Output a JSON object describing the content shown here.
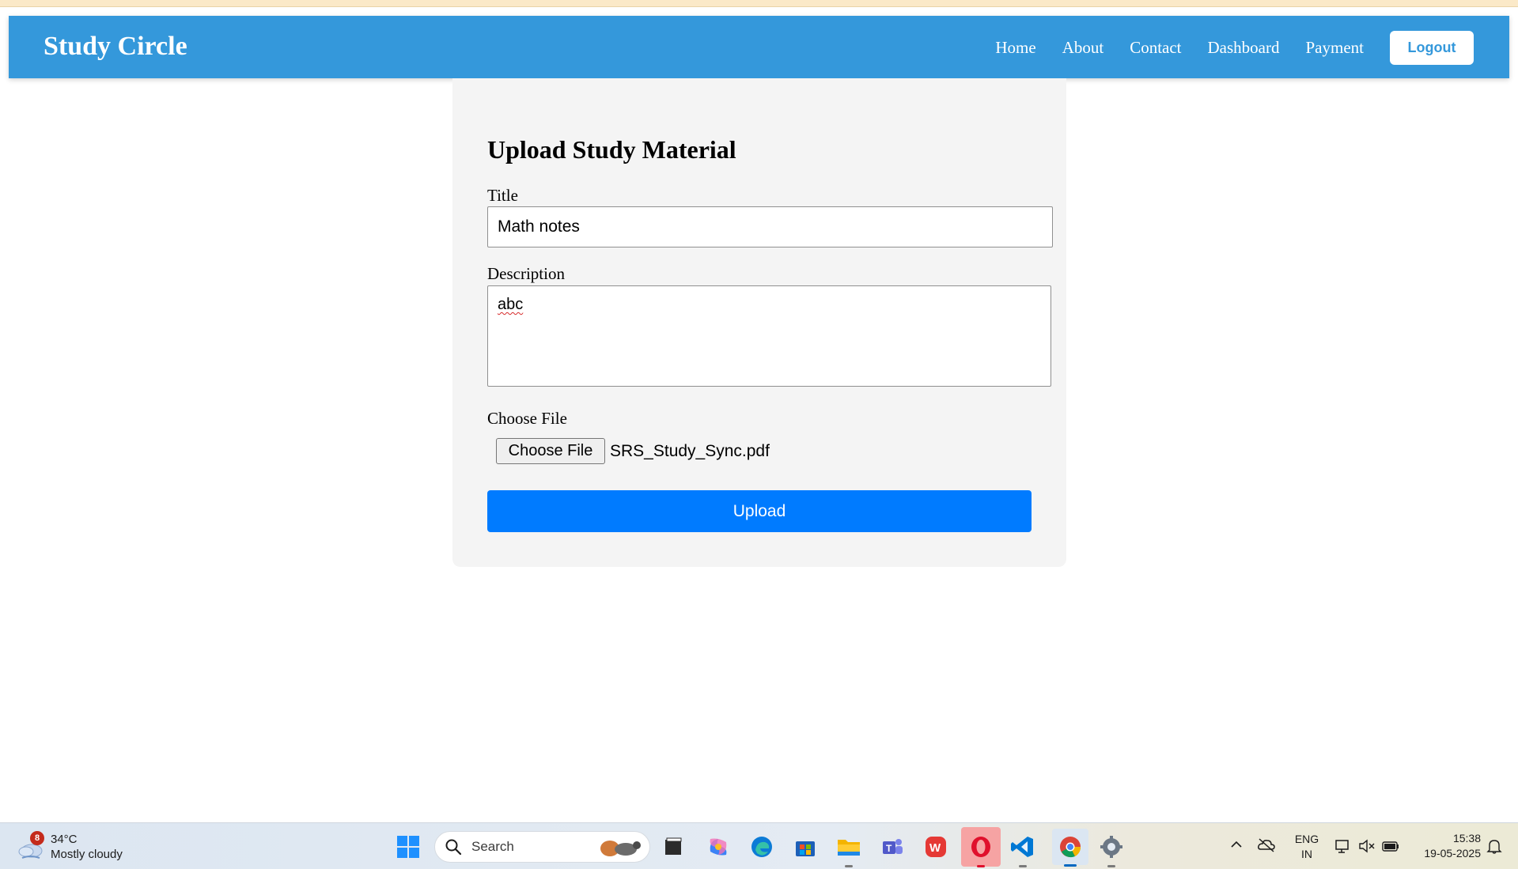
{
  "navbar": {
    "brand": "Study Circle",
    "links": [
      "Home",
      "About",
      "Contact",
      "Dashboard",
      "Payment"
    ],
    "logout_label": "Logout",
    "color": "#3498db"
  },
  "form": {
    "heading": "Upload Study Material",
    "title_label": "Title",
    "title_value": "Math notes",
    "description_label": "Description",
    "description_value": "abc",
    "file_label": "Choose File",
    "file_button_label": "Choose File",
    "file_name": "SRS_Study_Sync.pdf",
    "upload_label": "Upload",
    "upload_color": "#007bff"
  },
  "taskbar": {
    "weather": {
      "badge": "8",
      "temperature": "34°C",
      "condition": "Mostly cloudy",
      "icon": "cloud-icon"
    },
    "search_placeholder": "Search",
    "pinned": [
      "file-explorer-window-icon",
      "copilot-icon",
      "edge-icon",
      "microsoft-store-icon",
      "folder-icon",
      "teams-icon",
      "wps-office-icon",
      "opera-icon",
      "vscode-icon",
      "chrome-icon",
      "settings-icon"
    ],
    "language": {
      "line1": "ENG",
      "line2": "IN"
    },
    "clock": {
      "time": "15:38",
      "date": "19-05-2025"
    }
  }
}
